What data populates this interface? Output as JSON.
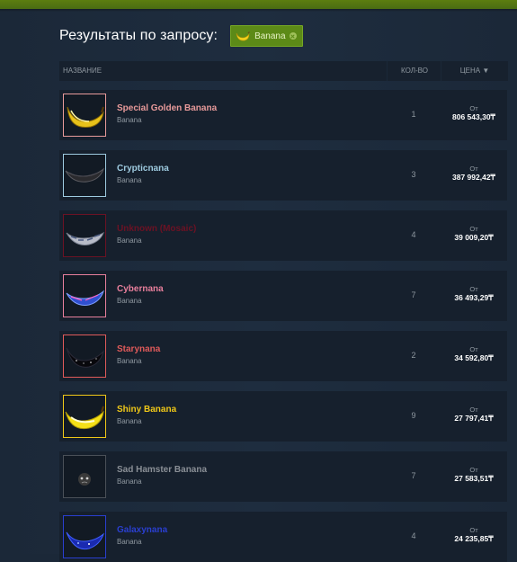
{
  "header": {
    "title": "Результаты по запросу:"
  },
  "filter_tag": {
    "label": "Banana",
    "icon": "banana-icon",
    "close_icon": "close-icon"
  },
  "table_header": {
    "name": "НАЗВАНИЕ",
    "quantity": "КОЛ-ВО",
    "price": "ЦЕНА ▼"
  },
  "colors": {
    "background": "#1b2838",
    "row": "#16202d",
    "accent_green": "#5c8a17",
    "secondary_text": "#8f98a0"
  },
  "items": [
    {
      "name": "Special Golden Banana",
      "game": "Banana",
      "quantity": "1",
      "price_from": "От",
      "price": "806 543,30₸",
      "name_color": "#e89a9a",
      "border_color": "#e89a9a",
      "icon": "golden-banana-icon"
    },
    {
      "name": "Crypticnana",
      "game": "Banana",
      "quantity": "3",
      "price_from": "От",
      "price": "387 992,42₸",
      "name_color": "#9ecbe0",
      "border_color": "#9ecbe0",
      "icon": "cryptic-banana-icon"
    },
    {
      "name": "Unknown (Mosaic)",
      "game": "Banana",
      "quantity": "4",
      "price_from": "От",
      "price": "39 009,20₸",
      "name_color": "#6b1224",
      "border_color": "#6b1224",
      "icon": "mosaic-banana-icon"
    },
    {
      "name": "Cybernana",
      "game": "Banana",
      "quantity": "7",
      "price_from": "От",
      "price": "36 493,29₸",
      "name_color": "#e87f9c",
      "border_color": "#e87f9c",
      "icon": "cyber-banana-icon"
    },
    {
      "name": "Starynana",
      "game": "Banana",
      "quantity": "2",
      "price_from": "От",
      "price": "34 592,80₸",
      "name_color": "#e05a5a",
      "border_color": "#e05a5a",
      "icon": "stary-banana-icon"
    },
    {
      "name": "Shiny Banana",
      "game": "Banana",
      "quantity": "9",
      "price_from": "От",
      "price": "27 797,41₸",
      "name_color": "#f0c818",
      "border_color": "#f0c818",
      "icon": "shiny-banana-icon"
    },
    {
      "name": "Sad Hamster Banana",
      "game": "Banana",
      "quantity": "7",
      "price_from": "От",
      "price": "27 583,51₸",
      "name_color": "#8a8f96",
      "border_color": "#4a5058",
      "icon": "hamster-banana-icon"
    },
    {
      "name": "Galaxynana",
      "game": "Banana",
      "quantity": "4",
      "price_from": "От",
      "price": "24 235,85₸",
      "name_color": "#2a3fd0",
      "border_color": "#2a3fd0",
      "icon": "galaxy-banana-icon"
    }
  ]
}
